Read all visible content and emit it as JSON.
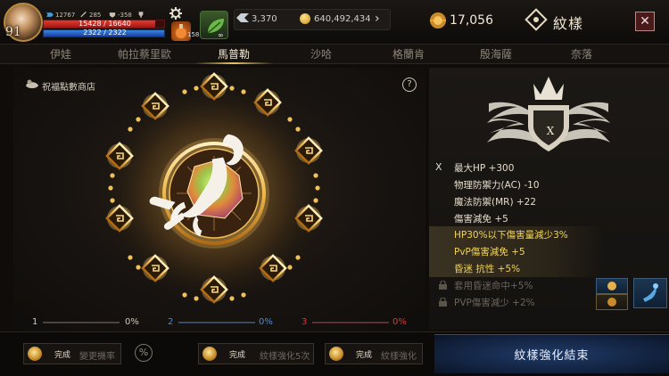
{
  "player": {
    "level": "91",
    "combat_power": "12767",
    "stat_2": "285",
    "stat_3": "-358",
    "hp_text": "15428 / 16640",
    "mp_text": "2322 / 2322",
    "hp_fraction": 0.927,
    "mp_fraction": 1.0
  },
  "items": {
    "potion_count": "158",
    "herb_count": "∞"
  },
  "currency": {
    "crystal": "3,370",
    "gold": "640,492,434",
    "blessing_points": "17,056"
  },
  "header": {
    "title": "紋樣",
    "close_label": "✕"
  },
  "tabs": [
    {
      "label": "伊娃"
    },
    {
      "label": "帕拉蔡里歐"
    },
    {
      "label": "馬普勒"
    },
    {
      "label": "沙哈"
    },
    {
      "label": "格蘭肯"
    },
    {
      "label": "殷海薩"
    },
    {
      "label": "奈落"
    }
  ],
  "active_tab": "馬普勒",
  "shop": {
    "label": "祝福點數商店"
  },
  "help_label": "?",
  "progress": [
    {
      "index": "1",
      "percent": "0%",
      "color": "#cfc8b8"
    },
    {
      "index": "2",
      "percent": "0%",
      "color": "#4a8ad6"
    },
    {
      "index": "3",
      "percent": "0%",
      "color": "#d43a3a"
    }
  ],
  "crest": {
    "grade": "X"
  },
  "stats": {
    "grade_mark": "X",
    "lines": [
      "最大HP +300",
      "物理防禦力(AC) -10",
      "魔法防禦(MR) +22",
      "傷害減免 +5"
    ],
    "highlighted": [
      "HP30%以下傷害量減少3%",
      "PvP傷害減免 +5",
      "昏迷 抗性 +5%"
    ],
    "locked": [
      "套用昏迷命中+5%",
      "PVP傷害減少 +2%"
    ]
  },
  "bottom": {
    "slots": [
      {
        "status": "完成",
        "name": "變更機率"
      },
      {
        "status": "完成",
        "name": "紋樣強化5次"
      },
      {
        "status": "完成",
        "name": "紋樣強化"
      }
    ],
    "percent_label": "%",
    "finish_label": "紋樣強化結束"
  },
  "icons": {
    "gear": "gear-icon",
    "potion": "potion-icon",
    "herb": "herb-icon",
    "crystal": "crystal-icon",
    "gold": "gold-coin-icon",
    "blessing": "blessing-icon",
    "pattern": "pattern-icon",
    "lock": "lock-icon",
    "scorpion": "scorpion-icon"
  },
  "colors": {
    "accent_gold": "#e7c66a",
    "highlight_text": "#f0d45a",
    "finish_blue": "#142646"
  }
}
